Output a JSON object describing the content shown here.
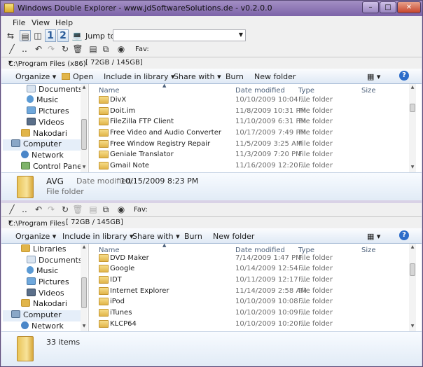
{
  "window": {
    "title": "Windows Double Explorer - www.jdSoftwareSolutions.de - v0.2.0.0"
  },
  "menu": [
    "File",
    "View",
    "Help"
  ],
  "toolbar": {
    "jump_label": "Jump to",
    "jump_value": "",
    "fav_label": "Fav:",
    "pane1": "1",
    "pane2": "2"
  },
  "top": {
    "path": "C:\\Program Files (x86)",
    "size": "[ 72GB / 145GB]",
    "commands": [
      "Organize",
      "Open",
      "Include in library",
      "Share with",
      "Burn",
      "New folder"
    ],
    "columns": [
      "Name",
      "Date modified",
      "Type",
      "Size"
    ],
    "nav": [
      "Documents",
      "Music",
      "Pictures",
      "Videos",
      "Nakodari",
      "Computer",
      "Network",
      "Control Panel"
    ],
    "files": [
      {
        "name": "DivX",
        "date": "10/10/2009 10:04 ...",
        "type": "File folder"
      },
      {
        "name": "Doit.im",
        "date": "11/8/2009 10:31 PM",
        "type": "File folder"
      },
      {
        "name": "FileZilla FTP Client",
        "date": "11/10/2009 6:31 PM",
        "type": "File folder"
      },
      {
        "name": "Free Video and Audio Converter",
        "date": "10/17/2009 7:49 PM",
        "type": "File folder"
      },
      {
        "name": "Free Window Registry Repair",
        "date": "11/5/2009 3:25 AM",
        "type": "File folder"
      },
      {
        "name": "Geniale Translator",
        "date": "11/3/2009 7:20 PM",
        "type": "File folder"
      },
      {
        "name": "Gmail Note",
        "date": "11/16/2009 12:20 ...",
        "type": "File folder"
      }
    ],
    "details": {
      "name": "AVG",
      "date_label": "Date modified:",
      "date": "10/15/2009 8:23 PM",
      "type": "File folder"
    }
  },
  "bottom": {
    "path": "C:\\Program Files",
    "size": "[ 72GB / 145GB]",
    "commands": [
      "Organize",
      "Include in library",
      "Share with",
      "Burn",
      "New folder"
    ],
    "columns": [
      "Name",
      "Date modified",
      "Type",
      "Size"
    ],
    "nav": [
      "Libraries",
      "Documents",
      "Music",
      "Pictures",
      "Videos",
      "Nakodari",
      "Computer",
      "Network"
    ],
    "files": [
      {
        "name": "DVD Maker",
        "date": "7/14/2009 1:47 PM",
        "type": "File folder"
      },
      {
        "name": "Google",
        "date": "10/14/2009 12:54 ...",
        "type": "File folder"
      },
      {
        "name": "IDT",
        "date": "10/11/2009 12:17 ...",
        "type": "File folder"
      },
      {
        "name": "Internet Explorer",
        "date": "11/14/2009 2:58 AM",
        "type": "File folder"
      },
      {
        "name": "iPod",
        "date": "10/10/2009 10:08 ...",
        "type": "File folder"
      },
      {
        "name": "iTunes",
        "date": "10/10/2009 10:09 ...",
        "type": "File folder"
      },
      {
        "name": "KLCP64",
        "date": "10/10/2009 10:20 ...",
        "type": "File folder"
      }
    ],
    "details": {
      "count": "33 items"
    }
  }
}
